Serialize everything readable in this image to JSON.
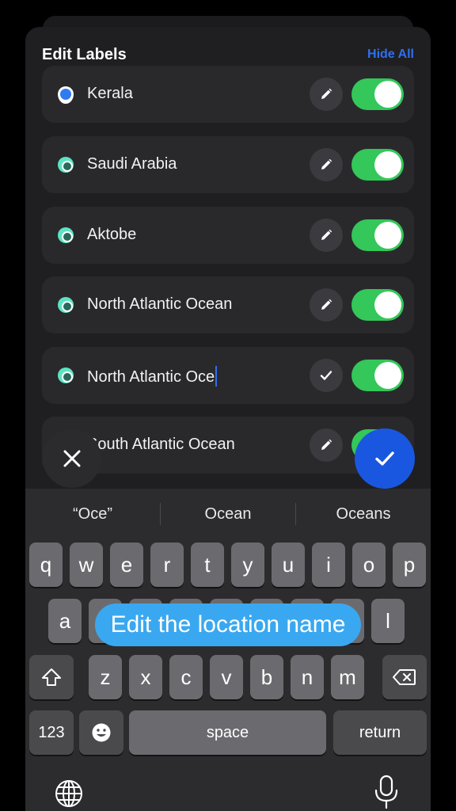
{
  "header": {
    "title": "Edit Labels",
    "hide_all": "Hide All"
  },
  "rows": [
    {
      "label": "Kerala",
      "marker": "location-pin-icon",
      "action": "pencil-icon",
      "enabled": true
    },
    {
      "label": "Saudi Arabia",
      "marker": "dot-icon",
      "action": "pencil-icon",
      "enabled": true
    },
    {
      "label": "Aktobe",
      "marker": "dot-icon",
      "action": "pencil-icon",
      "enabled": true
    },
    {
      "label": "North Atlantic Ocean",
      "marker": "dot-icon",
      "action": "pencil-icon",
      "enabled": true
    },
    {
      "label": "North Atlantic Oce",
      "marker": "dot-icon",
      "action": "checkmark-icon",
      "enabled": true,
      "editing": true
    },
    {
      "label": "South Atlantic Ocean",
      "marker": "dot-icon",
      "action": "pencil-icon",
      "enabled": true
    }
  ],
  "suggestions": [
    "“Oce”",
    "Ocean",
    "Oceans"
  ],
  "keyboard": {
    "row1": [
      "q",
      "w",
      "e",
      "r",
      "t",
      "y",
      "u",
      "i",
      "o",
      "p"
    ],
    "row2": [
      "a",
      "s",
      "d",
      "f",
      "g",
      "h",
      "j",
      "k",
      "l"
    ],
    "row3": [
      "z",
      "x",
      "c",
      "v",
      "b",
      "n",
      "m"
    ],
    "numbers": "123",
    "space": "space",
    "return": "return"
  },
  "tooltip": "Edit the location name",
  "colors": {
    "accent": "#1a57e0",
    "toggle_on": "#34c759",
    "tooltip": "#3aa8f0",
    "link": "#2f6ff0"
  }
}
